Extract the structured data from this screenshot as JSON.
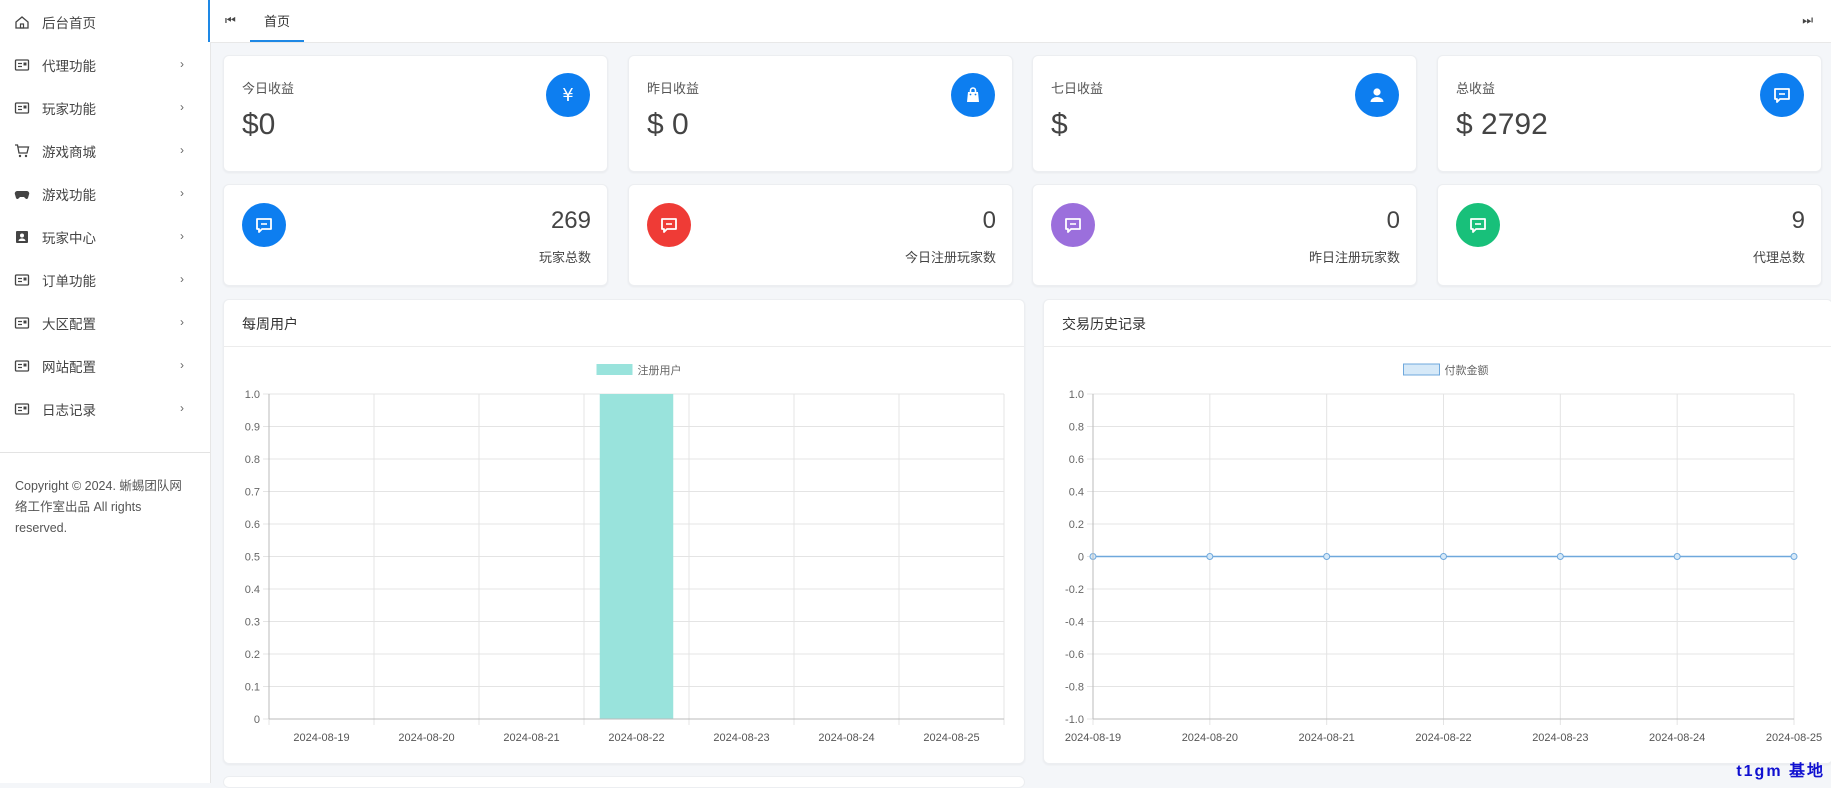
{
  "sidebar": {
    "items": [
      {
        "label": "后台首页",
        "icon": "home-icon",
        "has_chevron": false
      },
      {
        "label": "代理功能",
        "icon": "card-icon",
        "has_chevron": true
      },
      {
        "label": "玩家功能",
        "icon": "card-icon",
        "has_chevron": true
      },
      {
        "label": "游戏商城",
        "icon": "cart-icon",
        "has_chevron": true
      },
      {
        "label": "游戏功能",
        "icon": "gamepad-icon",
        "has_chevron": true
      },
      {
        "label": "玩家中心",
        "icon": "contact-icon",
        "has_chevron": true
      },
      {
        "label": "订单功能",
        "icon": "card-icon",
        "has_chevron": true
      },
      {
        "label": "大区配置",
        "icon": "card-icon",
        "has_chevron": true
      },
      {
        "label": "网站配置",
        "icon": "card-icon",
        "has_chevron": true
      },
      {
        "label": "日志记录",
        "icon": "card-icon",
        "has_chevron": true
      }
    ],
    "chevron": "›",
    "copyright": "Copyright © 2024. 蜥蜴团队网络工作室出品 All rights reserved."
  },
  "topbar": {
    "prev_icon": "⏮",
    "next_icon": "⏭",
    "tab_home": "首页"
  },
  "stats": [
    {
      "label": "今日收益",
      "value": "$0",
      "icon": "yen-icon",
      "color": "#0d7ef0"
    },
    {
      "label": "昨日收益",
      "value": "$ 0",
      "icon": "bag-icon",
      "color": "#0d7ef0"
    },
    {
      "label": "七日收益",
      "value": "$",
      "icon": "user-icon",
      "color": "#0d7ef0"
    },
    {
      "label": "总收益",
      "value": "$ 2792",
      "icon": "message-icon",
      "color": "#0d7ef0"
    }
  ],
  "counts": [
    {
      "value": "269",
      "label": "玩家总数",
      "icon": "message-icon",
      "color": "#0d7ef0"
    },
    {
      "value": "0",
      "label": "今日注册玩家数",
      "icon": "message-icon",
      "color": "#ef3b36"
    },
    {
      "value": "0",
      "label": "昨日注册玩家数",
      "icon": "message-icon",
      "color": "#9b6fdc"
    },
    {
      "value": "9",
      "label": "代理总数",
      "icon": "message-icon",
      "color": "#18c07a"
    }
  ],
  "chart_data": [
    {
      "type": "bar",
      "title": "每周用户",
      "categories": [
        "2024-08-19",
        "2024-08-20",
        "2024-08-21",
        "2024-08-22",
        "2024-08-23",
        "2024-08-24",
        "2024-08-25"
      ],
      "series": [
        {
          "name": "注册用户",
          "values": [
            0,
            0,
            0,
            1,
            0,
            0,
            0
          ],
          "color": "#99e3dc"
        }
      ],
      "ylim": [
        0,
        1.0
      ],
      "yticks": [
        "0",
        "0.1",
        "0.2",
        "0.3",
        "0.4",
        "0.5",
        "0.6",
        "0.7",
        "0.8",
        "0.9",
        "1.0"
      ],
      "legend": "top-center",
      "grid": true
    },
    {
      "type": "line",
      "title": "交易历史记录",
      "categories": [
        "2024-08-19",
        "2024-08-20",
        "2024-08-21",
        "2024-08-22",
        "2024-08-23",
        "2024-08-24",
        "2024-08-25"
      ],
      "series": [
        {
          "name": "付款金额",
          "values": [
            0,
            0,
            0,
            0,
            0,
            0,
            0
          ],
          "color": "#6fa8dc",
          "fill": "#d6e9f8"
        }
      ],
      "ylim": [
        -1.0,
        1.0
      ],
      "yticks": [
        "-1.0",
        "-0.8",
        "-0.6",
        "-0.4",
        "-0.2",
        "0",
        "0.2",
        "0.4",
        "0.6",
        "0.8",
        "1.0"
      ],
      "legend": "top-center",
      "grid": true
    }
  ],
  "watermark": "t1gm 基地"
}
